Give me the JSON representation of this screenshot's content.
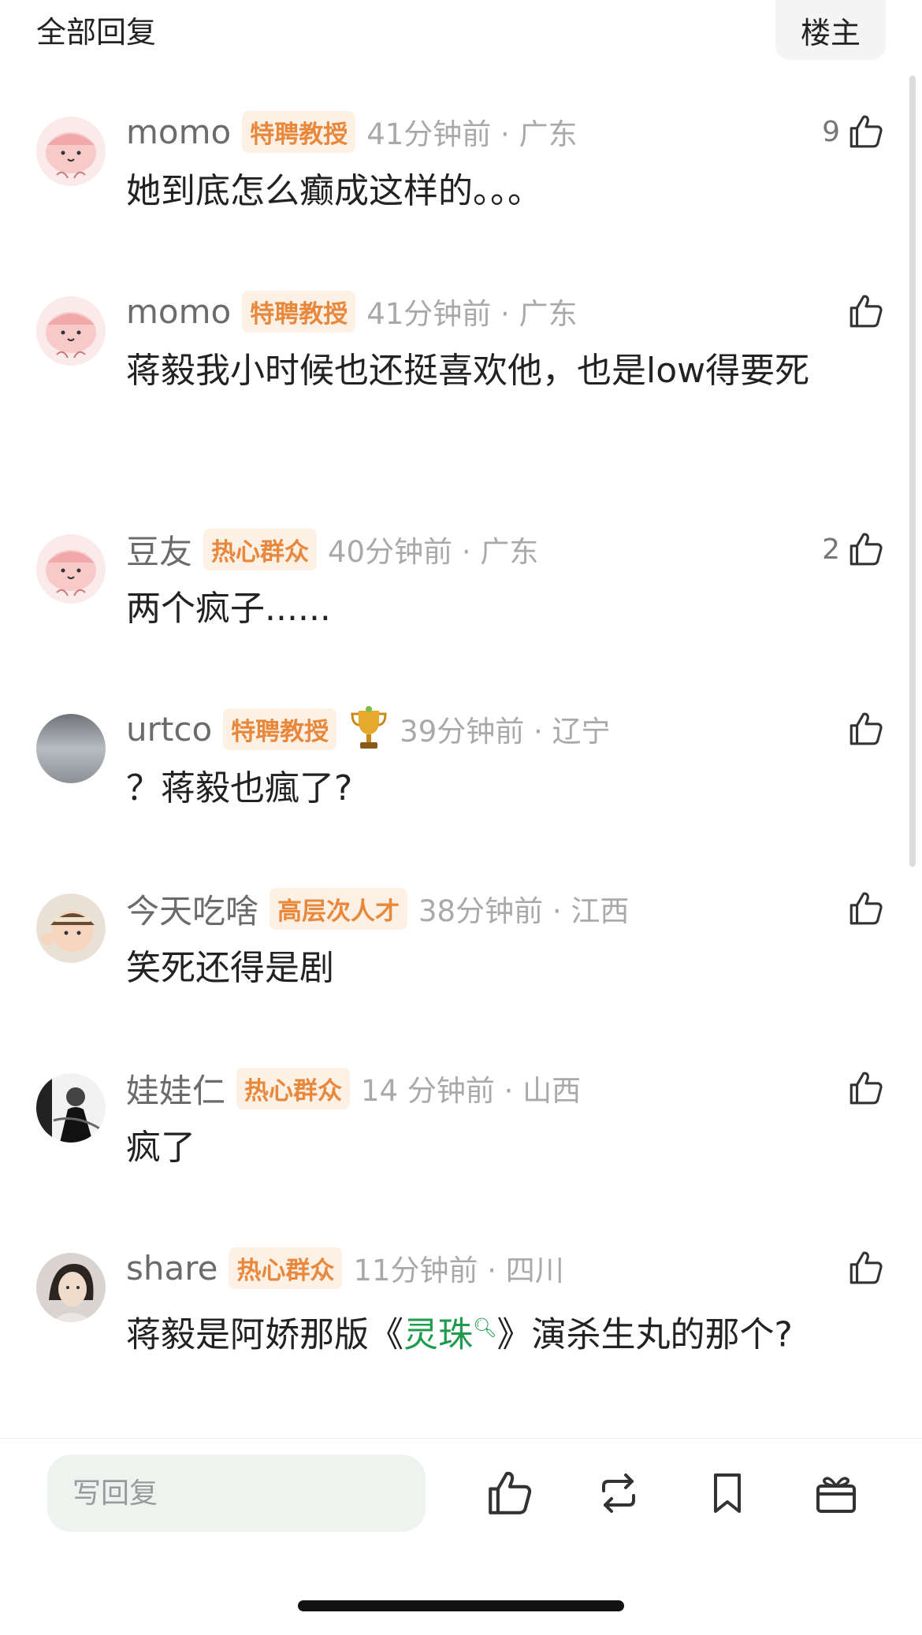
{
  "header": {
    "title": "全部回复",
    "op_button": "楼主"
  },
  "comments": [
    {
      "username": "momo",
      "badge": "特聘教授",
      "time": "41分钟前 · 广东",
      "likes": "9",
      "text": "她到底怎么癫成这样的。。。",
      "avatar": "pink-cartoon-avatar"
    },
    {
      "username": "momo",
      "badge": "特聘教授",
      "time": "41分钟前 · 广东",
      "likes": "",
      "text": "蒋毅我小时候也还挺喜欢他，也是low得要死",
      "avatar": "pink-cartoon-avatar"
    },
    {
      "username": "豆友",
      "badge": "热心群众",
      "time": "40分钟前 · 广东",
      "likes": "2",
      "text": "两个疯子......",
      "avatar": "pink-cartoon-avatar"
    },
    {
      "username": "urtco",
      "badge": "特聘教授",
      "time": "39分钟前 · 辽宁",
      "likes": "",
      "text": "？蒋毅也瘋了?",
      "avatar": "grey-photo-avatar",
      "trophy": "trophy-icon"
    },
    {
      "username": "今天吃啥",
      "badge": "高层次人才",
      "time": "38分钟前 · 江西",
      "likes": "",
      "text": "笑死还得是剧",
      "avatar": "baby-photo-avatar"
    },
    {
      "username": "娃娃仁",
      "badge": "热心群众",
      "time": "14 分钟前 · 山西",
      "likes": "",
      "text": "疯了",
      "avatar": "bw-photo-avatar"
    },
    {
      "username": "share",
      "badge": "热心群众",
      "time": "11分钟前 · 四川",
      "likes": "",
      "text_before": "蒋毅是阿娇那版《",
      "topic": "灵珠",
      "text_after": "》演杀生丸的那个?",
      "avatar": "woman-photo-avatar"
    }
  ],
  "bottom_bar": {
    "reply_placeholder": "写回复",
    "icons": [
      "like-icon",
      "repost-icon",
      "bookmark-icon",
      "gift-icon"
    ]
  },
  "colors": {
    "badge_bg": "#fdf1e6",
    "badge_text": "#e8883c",
    "topic_link": "#1e9b4c",
    "input_bg": "#eef3f0"
  }
}
